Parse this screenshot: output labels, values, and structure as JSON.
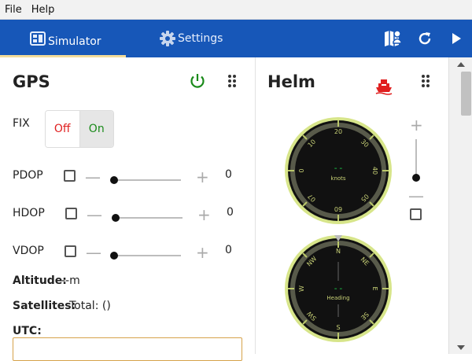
{
  "menu": {
    "file": "File",
    "help": "Help"
  },
  "tabs": [
    {
      "label": "Simulator",
      "icon": "dashboard-icon",
      "active": true
    },
    {
      "label": "Settings",
      "icon": "gear-icon",
      "active": false
    }
  ],
  "toolbar_icons": [
    "map-person-icon",
    "refresh-icon",
    "play-icon"
  ],
  "colors": {
    "toolbar": "#1757b8",
    "tab_indicator": "#f3dc9a",
    "power": "#1a8a1a",
    "boat": "#e02020",
    "off": "#e02020",
    "on": "#1a8a1a"
  },
  "gps": {
    "title": "GPS",
    "fix": {
      "label": "FIX",
      "off": "Off",
      "on": "On",
      "selected": "On"
    },
    "pdop": {
      "label": "PDOP",
      "value": "0"
    },
    "hdop": {
      "label": "HDOP",
      "value": "0"
    },
    "vdop": {
      "label": "VDOP",
      "value": "0"
    },
    "altitude": {
      "label": "Altitude:",
      "value": "--m"
    },
    "satellites": {
      "label": "Satellites:",
      "value": "Total: ()"
    },
    "utc": {
      "label": "UTC:"
    }
  },
  "helm": {
    "title": "Helm",
    "speed_gauge": {
      "ticks": [
        "20",
        "30",
        "40",
        "05",
        "09",
        "07",
        "0",
        "10"
      ],
      "readout": "--",
      "unit": "knots"
    },
    "heading_gauge": {
      "ticks": [
        "N",
        "NE",
        "E",
        "SE",
        "S",
        "SW",
        "W",
        "NW"
      ],
      "readout": "--",
      "unit": "Heading"
    }
  },
  "sign": {
    "minus": "—",
    "plus": "+"
  }
}
